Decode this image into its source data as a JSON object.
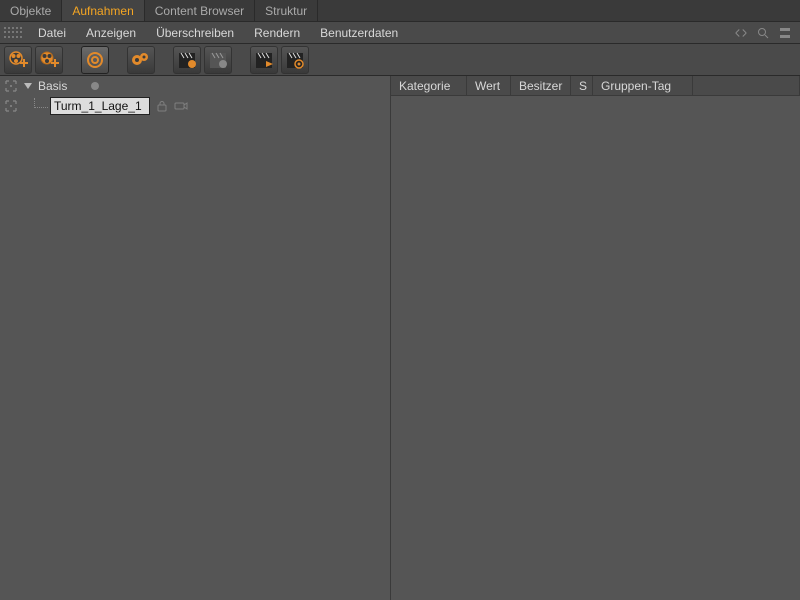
{
  "tabs": [
    {
      "label": "Objekte",
      "active": false
    },
    {
      "label": "Aufnahmen",
      "active": true
    },
    {
      "label": "Content Browser",
      "active": false
    },
    {
      "label": "Struktur",
      "active": false
    }
  ],
  "menu": {
    "items": [
      "Datei",
      "Anzeigen",
      "Überschreiben",
      "Rendern",
      "Benutzerdaten"
    ]
  },
  "tree": {
    "root": {
      "label": "Basis"
    },
    "child": {
      "label": "Turm_1_Lage_1"
    }
  },
  "columns": [
    {
      "label": "Kategorie",
      "w": 76
    },
    {
      "label": "Wert",
      "w": 44
    },
    {
      "label": "Besitzer",
      "w": 60
    },
    {
      "label": "S",
      "w": 22
    },
    {
      "label": "Gruppen-Tag",
      "w": 100
    }
  ]
}
